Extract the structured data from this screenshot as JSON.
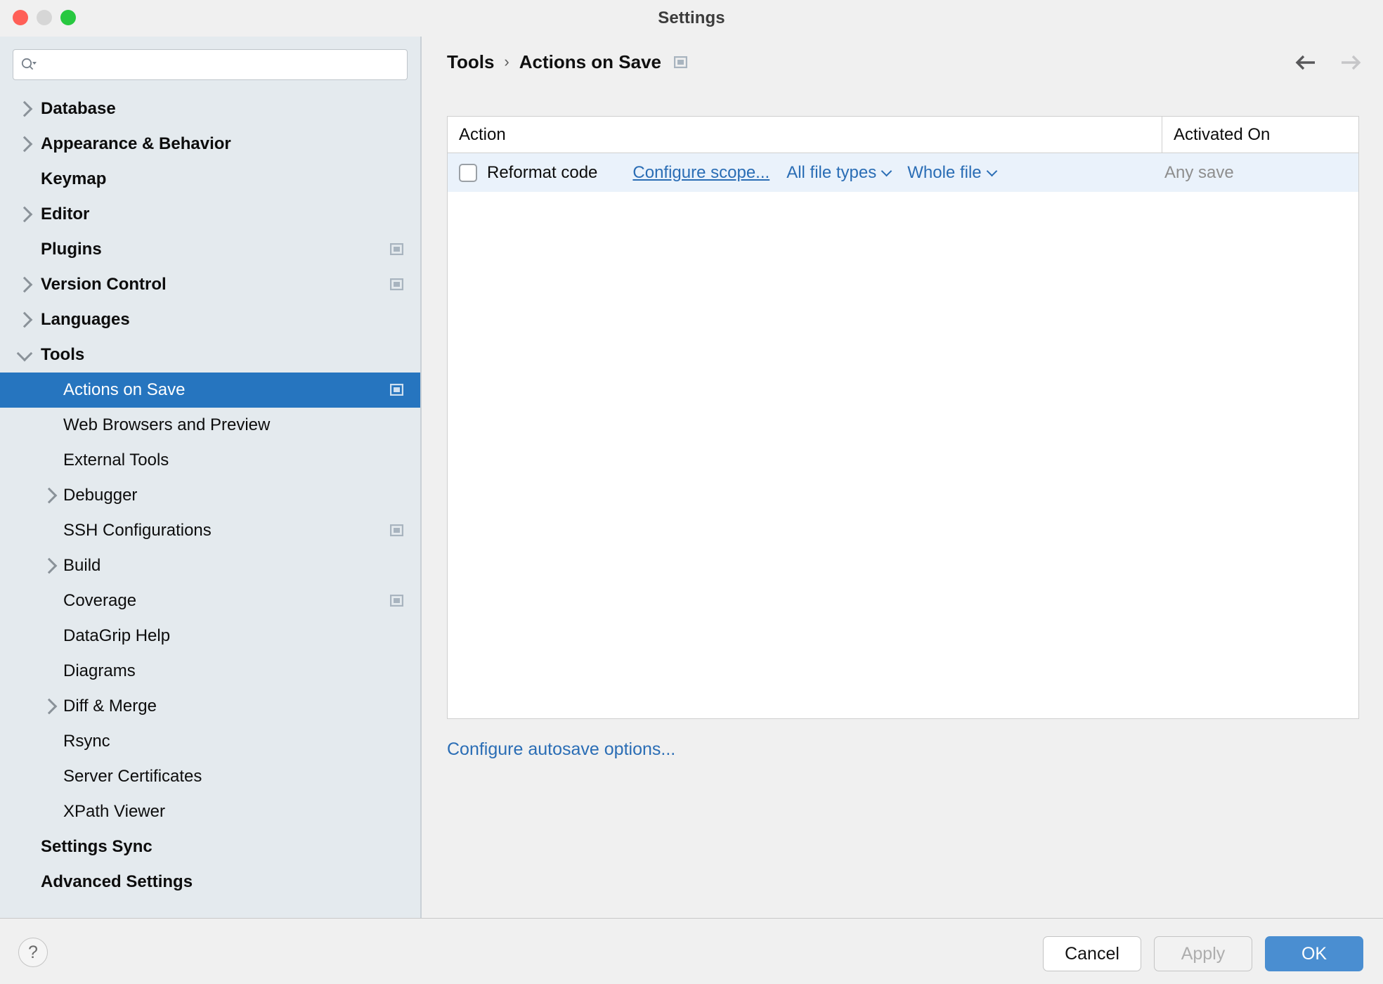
{
  "window": {
    "title": "Settings",
    "traffic_lights": [
      "close",
      "minimize",
      "maximize"
    ]
  },
  "sidebar": {
    "search": {
      "value": "",
      "placeholder": "",
      "icon": "search-icon"
    },
    "items": [
      {
        "label": "Database",
        "level": 1,
        "bold": true,
        "arrow": "right",
        "badge": false,
        "selected": false
      },
      {
        "label": "Appearance & Behavior",
        "level": 1,
        "bold": true,
        "arrow": "right",
        "badge": false,
        "selected": false
      },
      {
        "label": "Keymap",
        "level": 1,
        "bold": true,
        "arrow": "none",
        "badge": false,
        "selected": false
      },
      {
        "label": "Editor",
        "level": 1,
        "bold": true,
        "arrow": "right",
        "badge": false,
        "selected": false
      },
      {
        "label": "Plugins",
        "level": 1,
        "bold": true,
        "arrow": "none",
        "badge": true,
        "selected": false
      },
      {
        "label": "Version Control",
        "level": 1,
        "bold": true,
        "arrow": "right",
        "badge": true,
        "selected": false
      },
      {
        "label": "Languages",
        "level": 1,
        "bold": true,
        "arrow": "right",
        "badge": false,
        "selected": false
      },
      {
        "label": "Tools",
        "level": 1,
        "bold": true,
        "arrow": "down",
        "badge": false,
        "selected": false
      },
      {
        "label": "Actions on Save",
        "level": 2,
        "bold": false,
        "arrow": "none",
        "badge": true,
        "selected": true
      },
      {
        "label": "Web Browsers and Preview",
        "level": 2,
        "bold": false,
        "arrow": "none",
        "badge": false,
        "selected": false
      },
      {
        "label": "External Tools",
        "level": 2,
        "bold": false,
        "arrow": "none",
        "badge": false,
        "selected": false
      },
      {
        "label": "Debugger",
        "level": 2,
        "bold": false,
        "arrow": "right",
        "badge": false,
        "selected": false
      },
      {
        "label": "SSH Configurations",
        "level": 2,
        "bold": false,
        "arrow": "none",
        "badge": true,
        "selected": false
      },
      {
        "label": "Build",
        "level": 2,
        "bold": false,
        "arrow": "right",
        "badge": false,
        "selected": false
      },
      {
        "label": "Coverage",
        "level": 2,
        "bold": false,
        "arrow": "none",
        "badge": true,
        "selected": false
      },
      {
        "label": "DataGrip Help",
        "level": 2,
        "bold": false,
        "arrow": "none",
        "badge": false,
        "selected": false
      },
      {
        "label": "Diagrams",
        "level": 2,
        "bold": false,
        "arrow": "none",
        "badge": false,
        "selected": false
      },
      {
        "label": "Diff & Merge",
        "level": 2,
        "bold": false,
        "arrow": "right",
        "badge": false,
        "selected": false
      },
      {
        "label": "Rsync",
        "level": 2,
        "bold": false,
        "arrow": "none",
        "badge": false,
        "selected": false
      },
      {
        "label": "Server Certificates",
        "level": 2,
        "bold": false,
        "arrow": "none",
        "badge": false,
        "selected": false
      },
      {
        "label": "XPath Viewer",
        "level": 2,
        "bold": false,
        "arrow": "none",
        "badge": false,
        "selected": false
      },
      {
        "label": "Settings Sync",
        "level": 1,
        "bold": true,
        "arrow": "none",
        "badge": false,
        "selected": false
      },
      {
        "label": "Advanced Settings",
        "level": 1,
        "bold": true,
        "arrow": "none",
        "badge": false,
        "selected": false
      }
    ]
  },
  "breadcrumb": {
    "parent": "Tools",
    "separator": "›",
    "current": "Actions on Save",
    "badge_icon": "window-badge-icon"
  },
  "nav": {
    "back_icon": "arrow-left-icon",
    "forward_icon": "arrow-right-icon",
    "back_enabled": true,
    "forward_enabled": false
  },
  "table": {
    "columns": [
      "Action",
      "Activated On"
    ],
    "rows": [
      {
        "checked": false,
        "action": "Reformat code",
        "scope_link": "Configure scope...",
        "file_types": "All file types",
        "range": "Whole file",
        "activated_on": "Any save",
        "selected": true
      }
    ]
  },
  "links": {
    "autosave": "Configure autosave options..."
  },
  "footer": {
    "help": "?",
    "cancel": "Cancel",
    "apply": "Apply",
    "ok": "OK",
    "apply_enabled": false
  },
  "colors": {
    "accent": "#2675bf",
    "link": "#2a6db5",
    "selected_row": "#eaf2fb",
    "sidebar_bg": "#e4eaee",
    "primary_button": "#4a8ed1"
  }
}
